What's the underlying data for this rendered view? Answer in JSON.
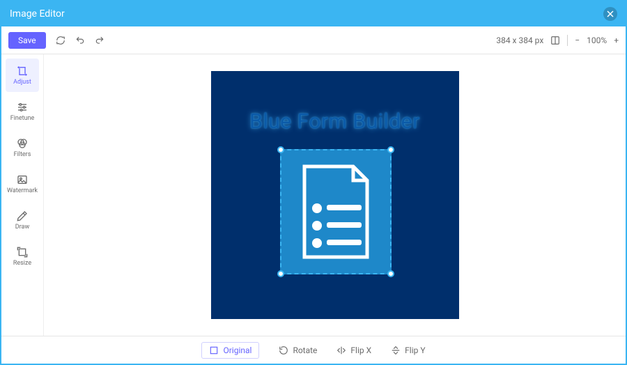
{
  "header": {
    "title": "Image Editor"
  },
  "toolbar": {
    "save_label": "Save",
    "dimensions": "384 x 384 px",
    "zoom": "100%"
  },
  "sidebar": {
    "tools": [
      {
        "label": "Adjust"
      },
      {
        "label": "Finetune"
      },
      {
        "label": "Filters"
      },
      {
        "label": "Watermark"
      },
      {
        "label": "Draw"
      },
      {
        "label": "Resize"
      }
    ]
  },
  "canvas": {
    "heading": "Blue Form Builder"
  },
  "bottombar": {
    "original": "Original",
    "rotate": "Rotate",
    "flipx": "Flip X",
    "flipy": "Flip Y"
  }
}
